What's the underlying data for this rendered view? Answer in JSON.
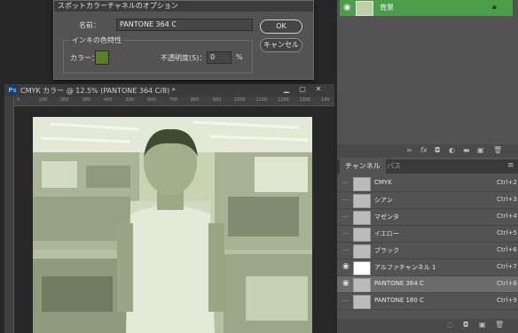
{
  "dialog": {
    "title": "スポットカラーチャネルのオプション",
    "name_label": "名前：",
    "name_value": "PANTONE 364 C",
    "ink_group_label": "インキの色特性",
    "color_label": "カラー：",
    "opacity_label": "不透明度(S)：",
    "opacity_value": "0",
    "opacity_unit": "%",
    "ok_label": "OK",
    "cancel_label": "キャンセル",
    "swatch_color": "#5a7d25"
  },
  "layers": {
    "layer_name": "背景"
  },
  "document": {
    "title": "CMYK カラー @ 12.5% (PANTONE 364 C/8) *",
    "ps_icon": "Ps",
    "ruler_ticks": [
      "0",
      "100",
      "200",
      "300",
      "400",
      "500",
      "600",
      "700",
      "800",
      "900",
      "1000",
      "1100",
      "1200",
      "1300",
      "140"
    ]
  },
  "channels": {
    "tabs": [
      "チャンネル",
      "パス"
    ],
    "items": [
      {
        "name": "CMYK",
        "shortcut": "Ctrl+2",
        "visible": false,
        "selected": false
      },
      {
        "name": "シアン",
        "shortcut": "Ctrl+3",
        "visible": false,
        "selected": false
      },
      {
        "name": "マゼンタ",
        "shortcut": "Ctrl+4",
        "visible": false,
        "selected": false
      },
      {
        "name": "イエロー",
        "shortcut": "Ctrl+5",
        "visible": false,
        "selected": false
      },
      {
        "name": "ブラック",
        "shortcut": "Ctrl+6",
        "visible": false,
        "selected": false
      },
      {
        "name": "アルファチャンネル 1",
        "shortcut": "Ctrl+7",
        "visible": true,
        "selected": false
      },
      {
        "name": "PANTONE 364 C",
        "shortcut": "Ctrl+8",
        "visible": true,
        "selected": true
      },
      {
        "name": "PANTONE 180 C",
        "shortcut": "Ctrl+9",
        "visible": false,
        "selected": false
      }
    ]
  },
  "colors": {
    "layer_highlight": "#4b9d4a",
    "photo_tint": "#c9d3b4"
  }
}
